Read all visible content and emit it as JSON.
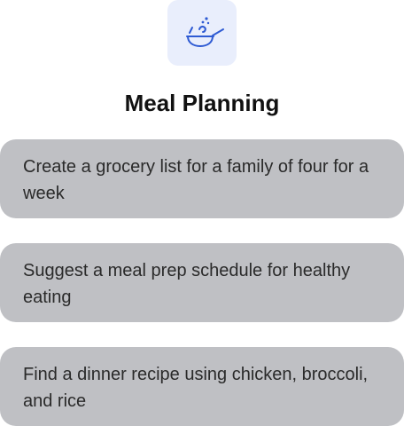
{
  "header": {
    "icon": "frying-pan-icon",
    "accent_color": "#2f5bd3",
    "tile_color": "#e9eefc",
    "title": "Meal Planning"
  },
  "suggestions": [
    {
      "text": "Create a grocery list for a family of four for a week"
    },
    {
      "text": "Suggest a meal prep schedule for healthy eating"
    },
    {
      "text": "Find a dinner recipe using chicken, broccoli, and rice"
    }
  ]
}
